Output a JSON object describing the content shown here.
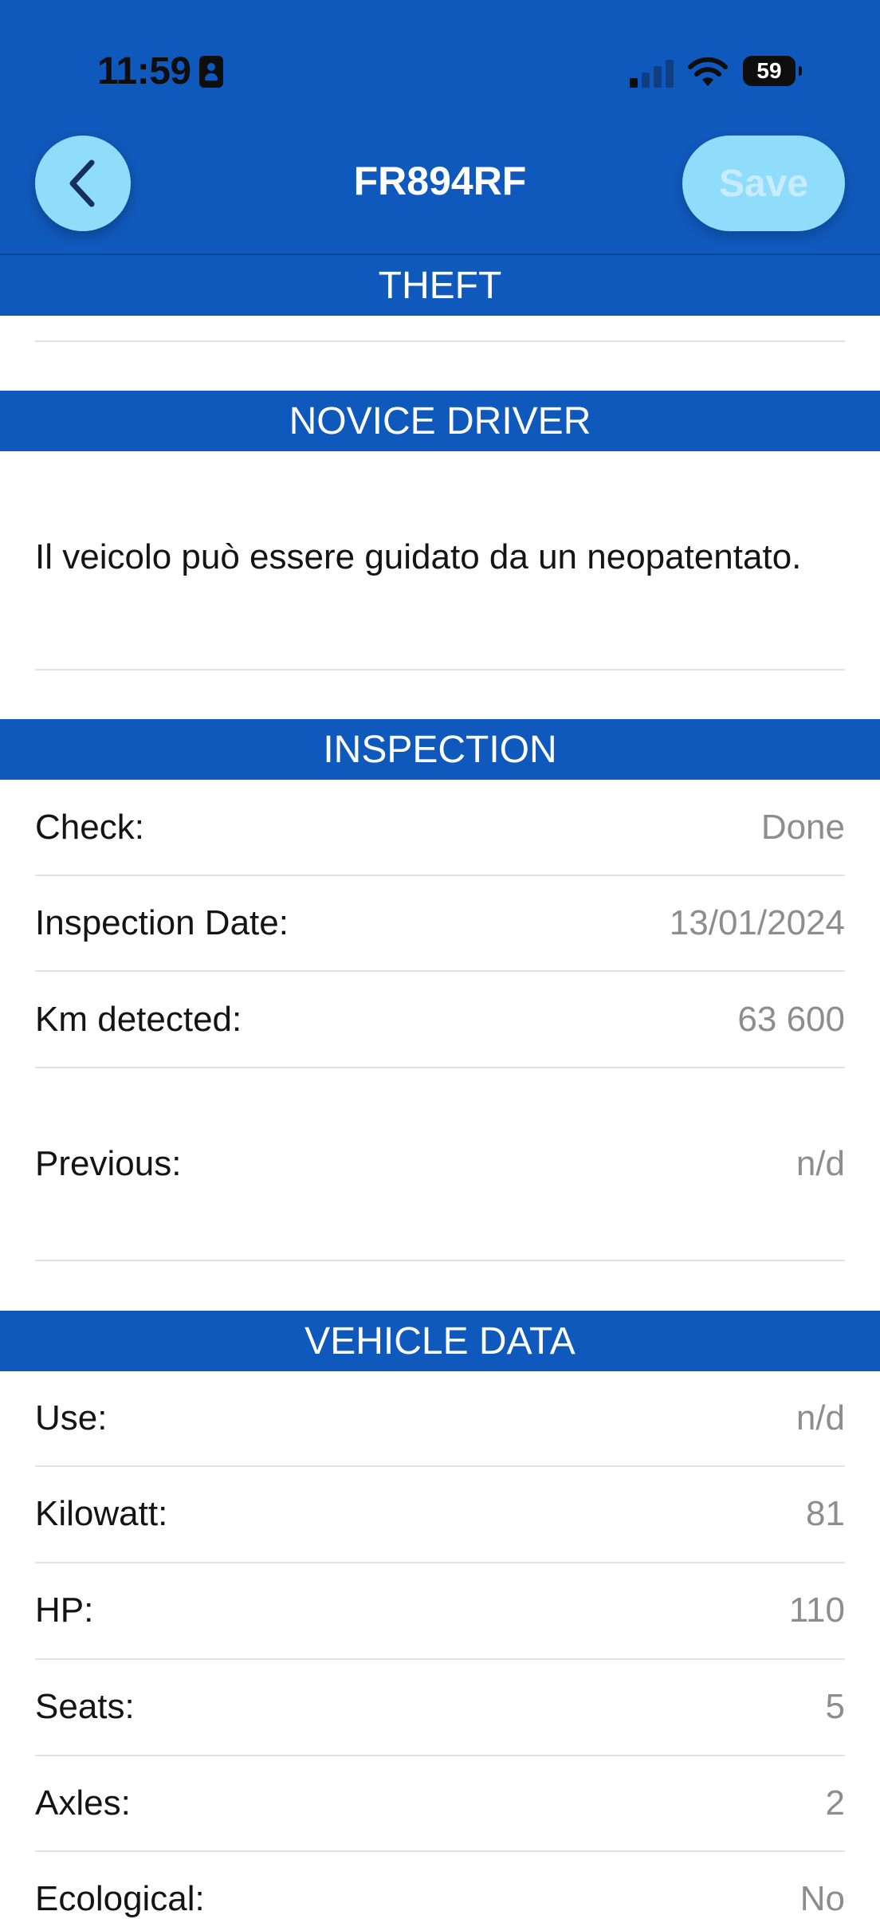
{
  "status_bar": {
    "time": "11:59",
    "battery": "59",
    "icons": [
      "id-badge-icon",
      "cellular-signal-icon",
      "wifi-icon",
      "battery-icon"
    ]
  },
  "header": {
    "title": "FR894RF",
    "save_label": "Save",
    "back_icon": "chevron-left-icon",
    "colors": {
      "bar": "#1059bc",
      "button": "#8fdcfb",
      "save_text_disabled": "#c6ecfd"
    }
  },
  "sections": {
    "theft": {
      "title": "THEFT"
    },
    "novice": {
      "title": "NOVICE DRIVER",
      "note": "Il veicolo può essere guidato da un neopatentato."
    },
    "inspection": {
      "title": "INSPECTION",
      "rows": [
        {
          "label": "Check:",
          "value": "Done"
        },
        {
          "label": "Inspection Date:",
          "value": "13/01/2024"
        },
        {
          "label": "Km detected:",
          "value": "63 600"
        },
        {
          "label": "Previous:",
          "value": "n/d"
        }
      ]
    },
    "vehicle": {
      "title": "VEHICLE DATA",
      "rows": [
        {
          "label": "Use:",
          "value": "n/d"
        },
        {
          "label": "Kilowatt:",
          "value": "81"
        },
        {
          "label": "HP:",
          "value": "110"
        },
        {
          "label": "Seats:",
          "value": "5"
        },
        {
          "label": "Axles:",
          "value": "2"
        },
        {
          "label": "Ecological:",
          "value": "No"
        }
      ]
    }
  }
}
